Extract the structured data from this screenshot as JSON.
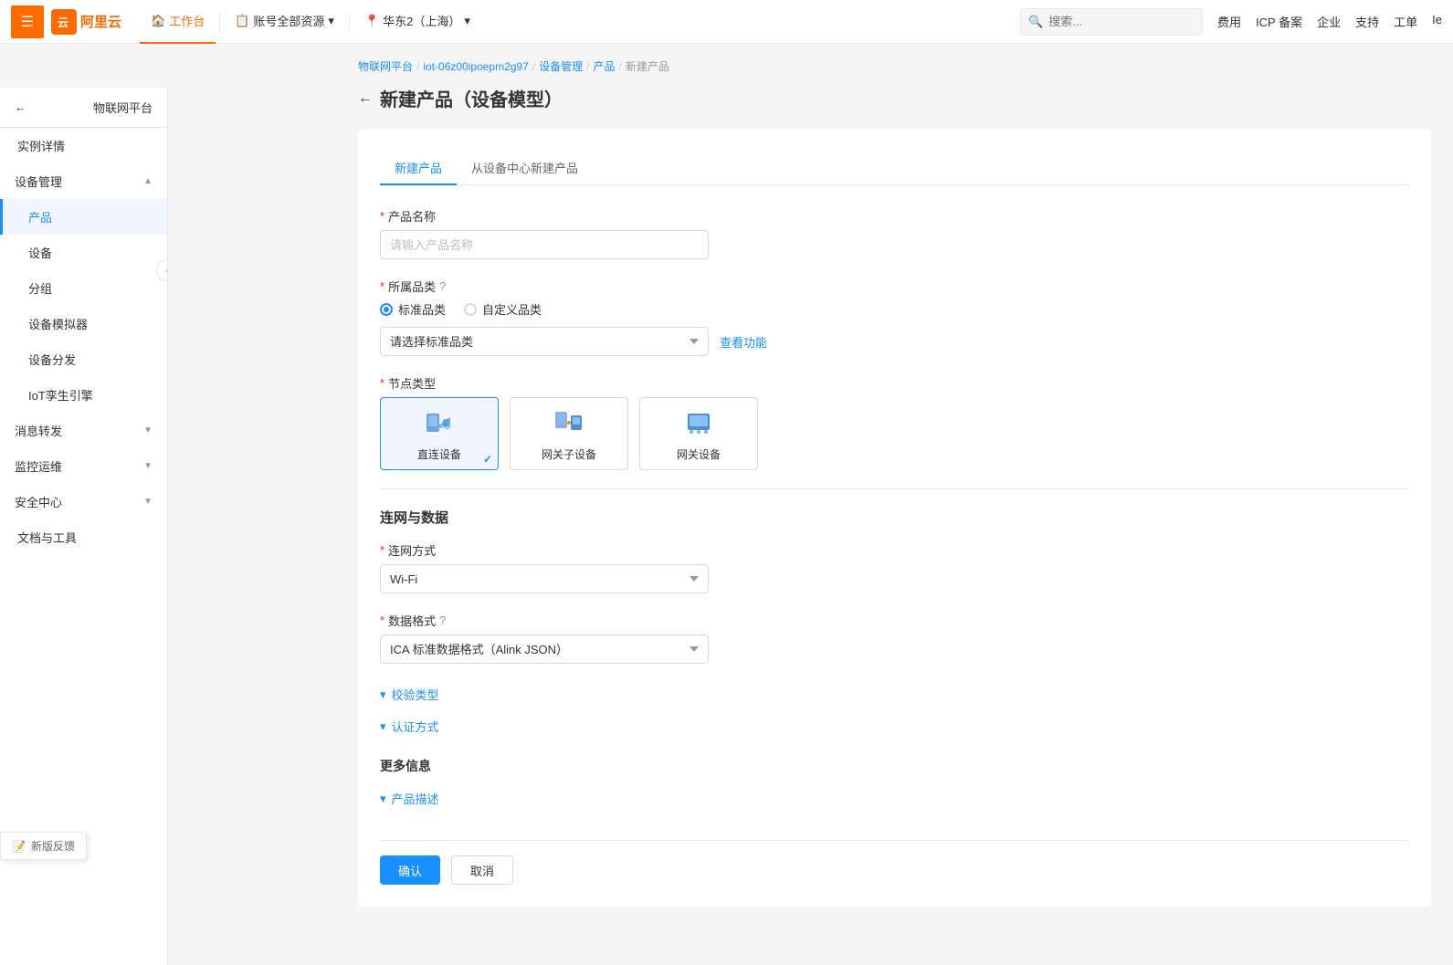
{
  "topNav": {
    "hamburger": "≡",
    "logoText": "阿里云",
    "logoShort": "云",
    "links": [
      {
        "label": "工作台",
        "icon": "🏠",
        "active": true
      },
      {
        "label": "账号全部资源",
        "icon": "📋",
        "hasArrow": true
      },
      {
        "label": "华东2（上海）",
        "icon": "📍",
        "hasArrow": true
      }
    ],
    "searchPlaceholder": "搜索...",
    "rightLinks": [
      "费用",
      "ICP 备案",
      "企业",
      "支持",
      "工单",
      "Ie"
    ]
  },
  "breadcrumb": {
    "items": [
      "物联网平台",
      "iot-06z00ipoepm2g97",
      "设备管理",
      "产品"
    ],
    "current": "新建产品"
  },
  "pageTitle": "新建产品（设备模型）",
  "backArrow": "←",
  "sidebar": {
    "header": "物联网平台",
    "backArrow": "←",
    "items": [
      {
        "label": "实例详情",
        "active": false,
        "hasChevron": false
      },
      {
        "label": "设备管理",
        "active": false,
        "hasChevron": true,
        "expanded": true
      },
      {
        "label": "产品",
        "active": true,
        "indent": true
      },
      {
        "label": "设备",
        "active": false,
        "indent": true
      },
      {
        "label": "分组",
        "active": false,
        "indent": true
      },
      {
        "label": "设备模拟器",
        "active": false,
        "indent": true
      },
      {
        "label": "设备分发",
        "active": false,
        "indent": true
      },
      {
        "label": "IoT孪生引擎",
        "active": false,
        "indent": true
      },
      {
        "label": "消息转发",
        "active": false,
        "hasChevron": true
      },
      {
        "label": "监控运维",
        "active": false,
        "hasChevron": true
      },
      {
        "label": "安全中心",
        "active": false,
        "hasChevron": true
      },
      {
        "label": "文档与工具",
        "active": false,
        "hasChevron": false
      }
    ]
  },
  "tabs": [
    {
      "label": "新建产品",
      "active": true
    },
    {
      "label": "从设备中心新建产品",
      "active": false
    }
  ],
  "form": {
    "productNameLabel": "产品名称",
    "productNameRequired": true,
    "productNamePlaceholder": "请输入产品名称",
    "categoryLabel": "所属品类",
    "categoryRequired": true,
    "categoryHelp": "?",
    "categoryOptions": [
      {
        "label": "标准品类",
        "value": "standard",
        "checked": true
      },
      {
        "label": "自定义品类",
        "value": "custom",
        "checked": false
      }
    ],
    "categorySelectPlaceholder": "请选择标准品类",
    "viewFuncLabel": "查看功能",
    "nodeTypeLabel": "节点类型",
    "nodeTypeRequired": true,
    "nodeTypes": [
      {
        "label": "直连设备",
        "selected": true
      },
      {
        "label": "网关子设备",
        "selected": false
      },
      {
        "label": "网关设备",
        "selected": false
      }
    ],
    "connectSectionTitle": "连网与数据",
    "connectMethodLabel": "连网方式",
    "connectMethodRequired": true,
    "connectMethodValue": "Wi-Fi",
    "dataFormatLabel": "数据格式",
    "dataFormatRequired": true,
    "dataFormatHelp": "?",
    "dataFormatValue": "ICA 标准数据格式（Alink JSON）",
    "collapsibleSections": [
      {
        "label": "校验类型",
        "expanded": true
      },
      {
        "label": "认证方式",
        "expanded": true
      }
    ],
    "moreInfoTitle": "更多信息",
    "moreInfoSections": [
      {
        "label": "产品描述",
        "expanded": true
      }
    ],
    "confirmLabel": "确认",
    "cancelLabel": "取消"
  },
  "feedback": {
    "icon": "📝",
    "label": "新版反馈"
  }
}
